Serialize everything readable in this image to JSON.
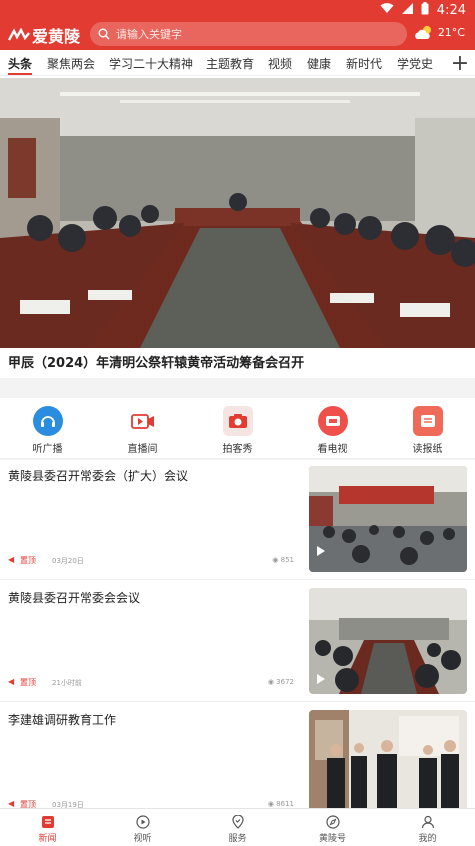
{
  "status_bar": {
    "time": "4:24"
  },
  "header": {
    "logo_text": "爱黄陵",
    "search_placeholder": "请输入关键字",
    "weather_temp": "21°C"
  },
  "tabs": [
    "头条",
    "聚焦两会",
    "学习二十大精神",
    "主题教育",
    "视频",
    "健康",
    "新时代",
    "学党史",
    "纟"
  ],
  "banner": {
    "title": "甲辰（2024）年清明公祭轩辕黄帝活动筹备会召开",
    "dot_count": 5,
    "active_dot": 2
  },
  "shortcuts": [
    {
      "label": "听广播",
      "icon": "radio-icon",
      "color": "#2b8de0"
    },
    {
      "label": "直播间",
      "icon": "live-camera-icon",
      "color": "#e23b31"
    },
    {
      "label": "拍客秀",
      "icon": "camera-icon",
      "color": "#e23b31"
    },
    {
      "label": "看电视",
      "icon": "tv-icon",
      "color": "#f0504a"
    },
    {
      "label": "读报纸",
      "icon": "newspaper-icon",
      "color": "#f06a5a"
    }
  ],
  "news": [
    {
      "title": "黄陵县委召开常委会（扩大）会议",
      "tag": "置顶",
      "time": "03月20日",
      "views": "851",
      "has_video": true
    },
    {
      "title": "黄陵县委召开常委会会议",
      "tag": "置顶",
      "time": "21小时前",
      "views": "3672",
      "has_video": true
    },
    {
      "title": "李建雄调研教育工作",
      "tag": "置顶",
      "time": "03月19日",
      "views": "8611",
      "has_video": false
    }
  ],
  "bottom_nav": [
    {
      "label": "新闻",
      "icon": "news-icon"
    },
    {
      "label": "视听",
      "icon": "play-icon"
    },
    {
      "label": "服务",
      "icon": "service-icon"
    },
    {
      "label": "黄陵号",
      "icon": "compass-icon"
    },
    {
      "label": "我的",
      "icon": "user-icon"
    }
  ],
  "colors": {
    "brand_red": "#e23b31"
  }
}
